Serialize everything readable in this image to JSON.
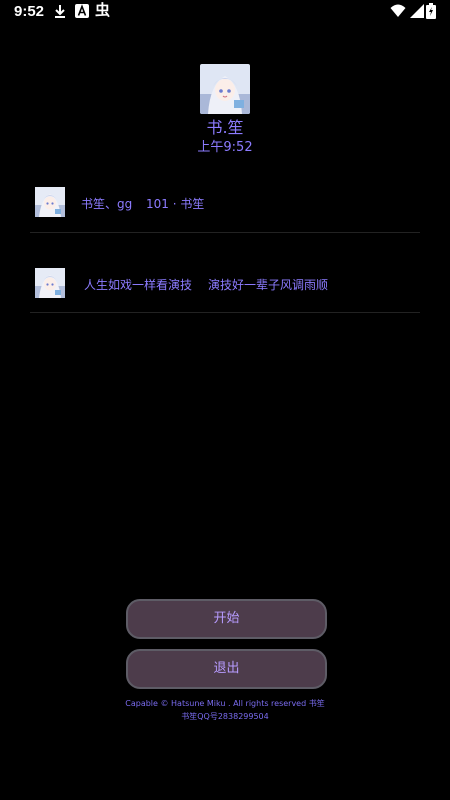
{
  "status_bar": {
    "time": "9:52",
    "chong_glyph": "虫",
    "icons": [
      "download-icon",
      "a-icon",
      "chong-icon",
      "wifi-icon",
      "signal-icon",
      "battery-icon"
    ]
  },
  "header": {
    "name": "书.笙",
    "time": "上午9:52"
  },
  "list": [
    {
      "name": "书笙、gg",
      "message": "101 · 书笙"
    },
    {
      "name": "人生如戏一样看演技",
      "message": "演技好一辈子风调雨顺"
    }
  ],
  "buttons": {
    "start": "开始",
    "exit": "退出"
  },
  "footer": {
    "line1": "Capable © Hatsune Miku . All rights reserved 书笙",
    "line2": "书笙QQ号2838299504"
  },
  "colors": {
    "background": "#000000",
    "accent_text": "#8c7bff",
    "button_fill": "#4d3c4b",
    "button_border": "#5e5c66"
  }
}
